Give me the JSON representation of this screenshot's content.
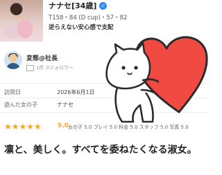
{
  "profile": {
    "name": "ナナセ[34歳]",
    "stats": "T158・84 (D cup)・57・82",
    "catchphrase": "逆らえない安心感で支配"
  },
  "reviewer": {
    "name": "変態@社長",
    "meta_count": "1件",
    "followers": "0フォロワー"
  },
  "info": {
    "visit_label": "訪問日",
    "visit_value": "2026年6月1日",
    "played_label": "遊んだ女の子",
    "played_value": "ナナセ"
  },
  "rating": {
    "stars": "★★★★★",
    "score": "5.0",
    "details": "女の子 5.0 プレイ 5.0 料金 5.0 スタッフ 5.0 写真 5.0"
  },
  "headline": "凛と、美しく。すべてを委ねたくなる淑女。",
  "colors": {
    "accent": "#f5a623",
    "verified": "#2f8cf0",
    "heart": "#f04a42"
  }
}
